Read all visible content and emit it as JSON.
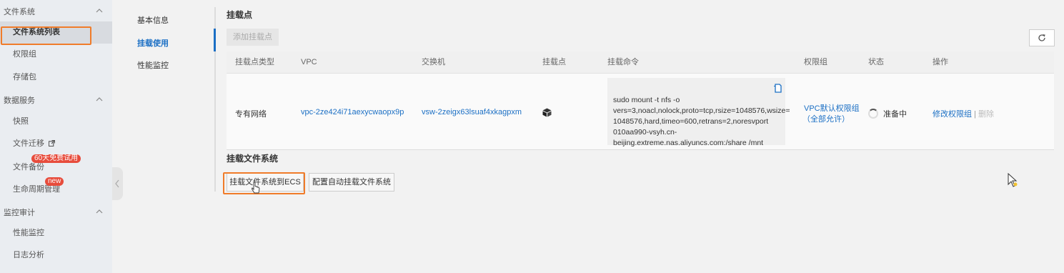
{
  "sidebar": {
    "groups": [
      {
        "label": "文件系统"
      },
      {
        "label": "数据服务"
      },
      {
        "label": "监控审计"
      }
    ],
    "items": [
      {
        "label": "文件系统列表"
      },
      {
        "label": "权限组"
      },
      {
        "label": "存储包"
      },
      {
        "label": "快照"
      },
      {
        "label": "文件迁移"
      },
      {
        "label": "文件备份",
        "badge": "60天免费试用"
      },
      {
        "label": "生命周期管理",
        "badge": "new"
      },
      {
        "label": "性能监控"
      },
      {
        "label": "日志分析"
      }
    ]
  },
  "tabs": [
    "基本信息",
    "挂载使用",
    "性能监控"
  ],
  "mount_section": {
    "title": "挂载点",
    "add_button": "添加挂载点",
    "refresh_icon": "refresh-icon",
    "columns": [
      "挂载点类型",
      "VPC",
      "交换机",
      "挂载点",
      "挂载命令",
      "权限组",
      "状态",
      "操作"
    ],
    "row": {
      "type": "专有网络",
      "vpc": "vpc-2ze424i71aexycwaopx9p",
      "vswitch": "vsw-2zeigx63lsuaf4xkagpxm",
      "mount_icon": "cube-icon",
      "command": "sudo mount -t nfs -o\nvers=3,noacl,nolock,proto=tcp,rsize=1048576,wsize=\n1048576,hard,timeo=600,retrans=2,noresvport\n010aa990-vsyh.cn-\nbeijing.extreme.nas.aliyuncs.com:/share /mnt",
      "perm_group_line1": "VPC默认权限组",
      "perm_group_line2": "（全部允许）",
      "status": "准备中",
      "action_modify": "修改权限组",
      "action_separator": "|",
      "action_delete": "删除"
    }
  },
  "mount_fs_section": {
    "title": "挂载文件系统",
    "btn_ecs": "挂载文件系统到ECS",
    "btn_auto": "配置自动挂载文件系统"
  },
  "colors": {
    "accent": "#1b6fc4",
    "highlight": "#f07c2a",
    "badge": "#e74c3c"
  }
}
